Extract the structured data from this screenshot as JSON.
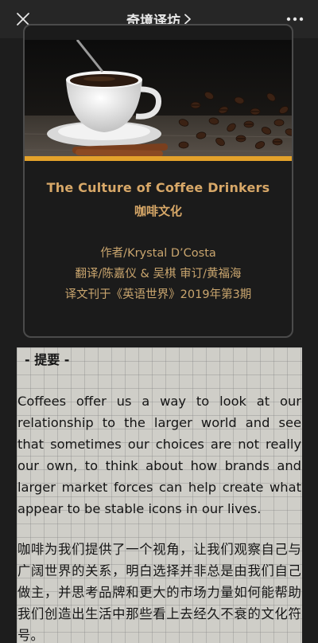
{
  "topbar": {
    "title": "奇境译坊",
    "chevron": "›",
    "close_icon": "close-icon",
    "more_icon": "more-horizontal-icon"
  },
  "article": {
    "title_en": "The Culture of Coffee Drinkers",
    "title_cn": "咖啡文化",
    "author": "作者/Krystal D’Costa",
    "translators": "翻译/陈嘉仪 & 吴棋  审订/黄福海",
    "published": "译文刊于《英语世界》2019年第3期",
    "accent_color": "#e4a22b"
  },
  "summary": {
    "heading": "- 提要 -",
    "paragraph_en": "Coffees offer us a way to look at our relationship to the larger world and see that sometimes our choices are not really our own, to think about how brands and larger market forces can help create what appear to be stable icons in our lives.",
    "paragraph_cn": "咖啡为我们提供了一个视角，让我们观察自己与广阔世界的关系，明白选择并非总是由我们自己做主，并思考品牌和更大的市场力量如何能帮助我们创造出生活中那些看上去经久不衰的文化符号。"
  }
}
